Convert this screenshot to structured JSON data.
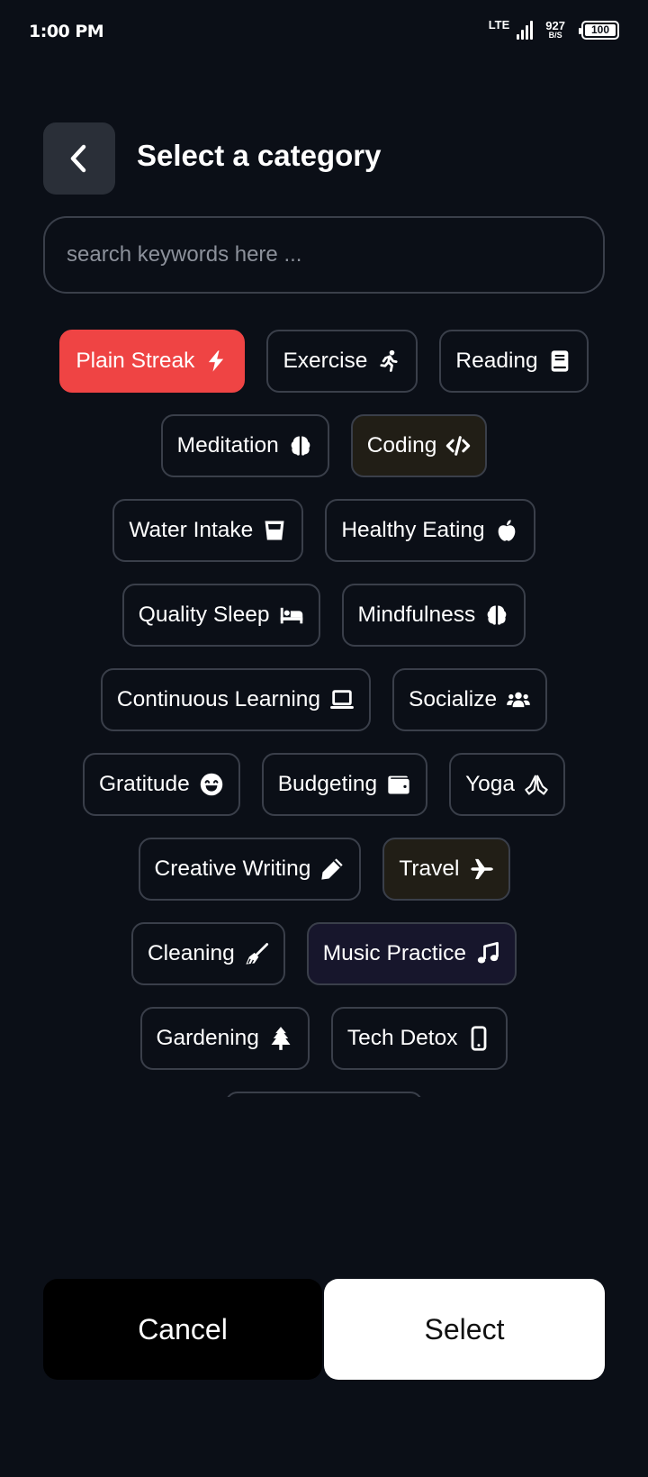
{
  "status_bar": {
    "time": "1:00 PM",
    "network_type": "LTE",
    "net_speed_value": "927",
    "net_speed_unit": "B/S",
    "battery": "100"
  },
  "header": {
    "title": "Select a category",
    "back_icon": "chevron-left-icon"
  },
  "search": {
    "placeholder": "search keywords here ..."
  },
  "categories": [
    {
      "label": "Plain Streak",
      "icon": "bolt-icon"
    },
    {
      "label": "Exercise",
      "icon": "running-icon"
    },
    {
      "label": "Reading",
      "icon": "book-icon"
    },
    {
      "label": "Meditation",
      "icon": "brain-icon"
    },
    {
      "label": "Coding",
      "icon": "code-icon"
    },
    {
      "label": "Water Intake",
      "icon": "glass-icon"
    },
    {
      "label": "Healthy Eating",
      "icon": "apple-icon"
    },
    {
      "label": "Quality Sleep",
      "icon": "bed-icon"
    },
    {
      "label": "Mindfulness",
      "icon": "brain-icon"
    },
    {
      "label": "Continuous Learning",
      "icon": "laptop-icon"
    },
    {
      "label": "Socialize",
      "icon": "users-icon"
    },
    {
      "label": "Gratitude",
      "icon": "smile-icon"
    },
    {
      "label": "Budgeting",
      "icon": "wallet-icon"
    },
    {
      "label": "Yoga",
      "icon": "praying-hands-icon"
    },
    {
      "label": "Creative Writing",
      "icon": "pencil-icon"
    },
    {
      "label": "Travel",
      "icon": "plane-icon"
    },
    {
      "label": "Cleaning",
      "icon": "broom-icon"
    },
    {
      "label": "Music Practice",
      "icon": "music-icon"
    },
    {
      "label": "Gardening",
      "icon": "tree-icon"
    },
    {
      "label": "Tech Detox",
      "icon": "phone-icon"
    }
  ],
  "selected_category": "Plain Streak",
  "colors": {
    "background": "#0b0f17",
    "selected_chip": "#ef4444",
    "chip_border": "#3a3f4a"
  },
  "actions": {
    "cancel_label": "Cancel",
    "select_label": "Select"
  }
}
